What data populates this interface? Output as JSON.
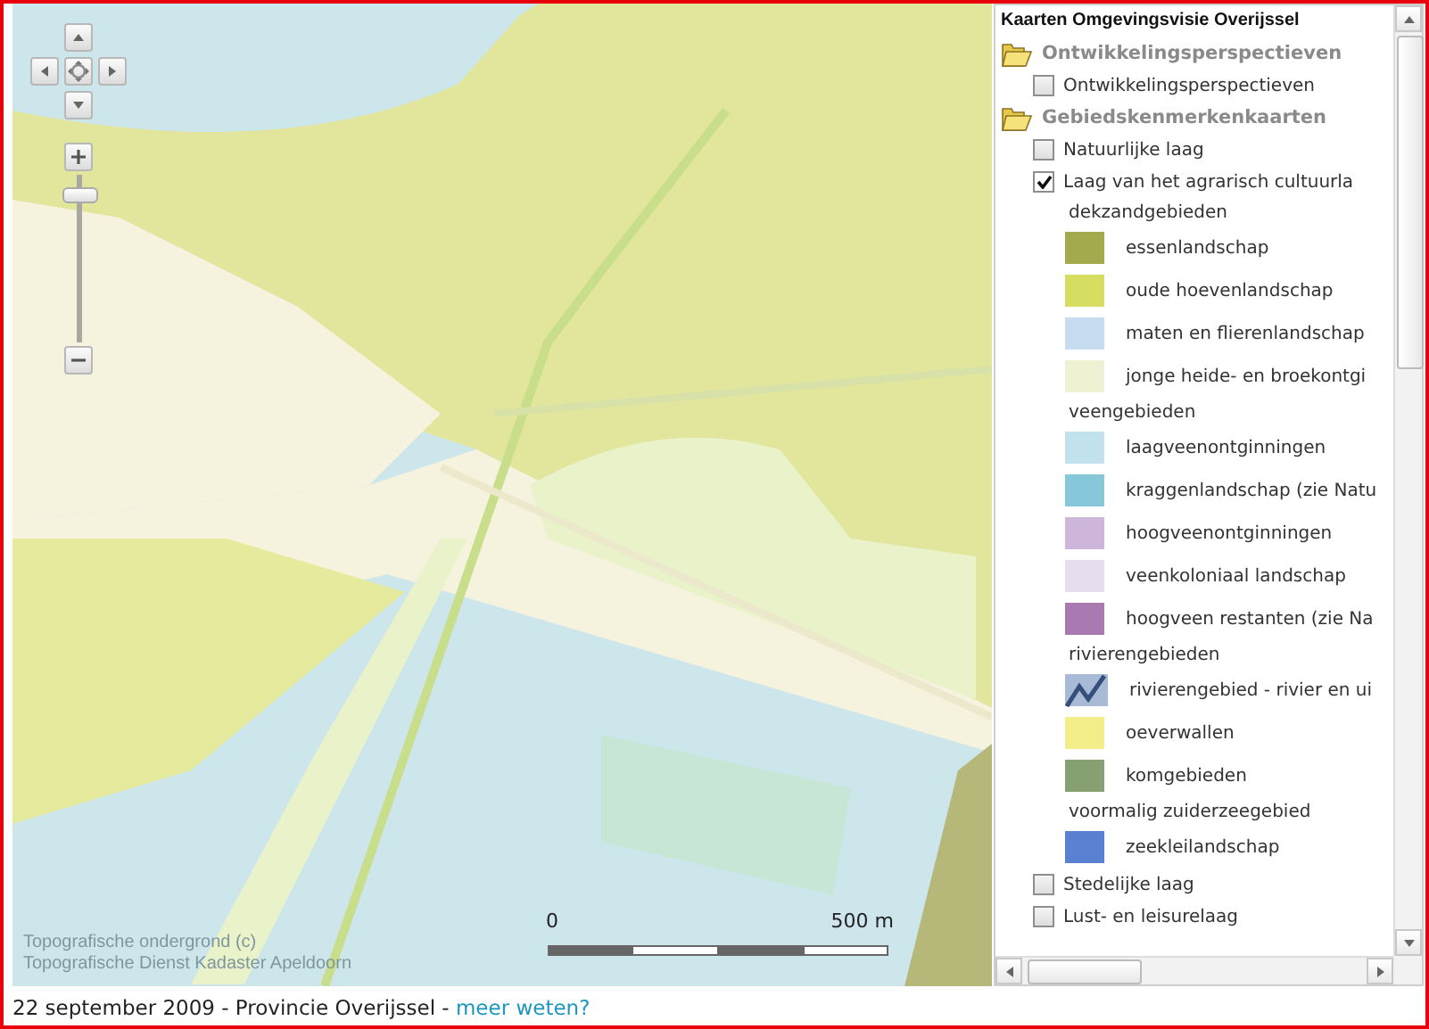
{
  "map": {
    "zoom_slider": {
      "level": 0.92
    },
    "attribution": [
      "Topografische ondergrond (c)",
      "Topografische Dienst Kadaster Apeldoorn"
    ],
    "scale": {
      "start": "0",
      "end": "500 m"
    }
  },
  "legend": {
    "title": "Kaarten Omgevingsvisie Overijssel",
    "items": [
      {
        "kind": "folder",
        "label": "Ontwikkelingsperspectieven",
        "children": [
          {
            "kind": "layer",
            "label": "Ontwikkelingsperspectieven",
            "checked": false
          }
        ]
      },
      {
        "kind": "folder",
        "label": "Gebiedskenmerkenkaarten",
        "children": [
          {
            "kind": "layer",
            "label": "Natuurlijke laag",
            "checked": false
          },
          {
            "kind": "layer",
            "label": "Laag van het agrarisch cultuurla",
            "checked": true,
            "children": [
              {
                "kind": "heading",
                "label": "dekzandgebieden"
              },
              {
                "kind": "swatch",
                "label": "essenlandschap",
                "color": "#a3aa4e"
              },
              {
                "kind": "swatch",
                "label": "oude hoevenlandschap",
                "color": "#d6de62"
              },
              {
                "kind": "swatch",
                "label": "maten en flierenlandschap",
                "color": "#c6dcf0"
              },
              {
                "kind": "swatch",
                "label": "jonge heide- en broekontgi",
                "color": "#eff2d2"
              },
              {
                "kind": "heading",
                "label": "veengebieden"
              },
              {
                "kind": "swatch",
                "label": "laagveenontginningen",
                "color": "#c2e2ee"
              },
              {
                "kind": "swatch",
                "label": "kraggenlandschap (zie Natu",
                "color": "#86c8da"
              },
              {
                "kind": "swatch",
                "label": "hoogveenontginningen",
                "color": "#cdb6da"
              },
              {
                "kind": "swatch",
                "label": "veenkoloniaal landschap",
                "color": "#e6ddee"
              },
              {
                "kind": "swatch",
                "label": "hoogveen restanten (zie Na",
                "color": "#a97ab2"
              },
              {
                "kind": "heading",
                "label": "rivierengebieden"
              },
              {
                "kind": "line",
                "label": "rivierengebied - rivier en ui",
                "color": "#34507a"
              },
              {
                "kind": "swatch",
                "label": "oeverwallen",
                "color": "#f4ee8a"
              },
              {
                "kind": "swatch",
                "label": "komgebieden",
                "color": "#86a072"
              },
              {
                "kind": "heading",
                "label": "voormalig zuiderzeegebied"
              },
              {
                "kind": "swatch",
                "label": "zeekleilandschap",
                "color": "#5a80d2"
              }
            ]
          },
          {
            "kind": "layer",
            "label": "Stedelijke laag",
            "checked": false
          },
          {
            "kind": "layer",
            "label": "Lust- en leisurelaag",
            "checked": false
          }
        ]
      }
    ]
  },
  "footer": {
    "text": "22 september 2009 - Provincie Overijssel - ",
    "link": "meer weten?"
  }
}
